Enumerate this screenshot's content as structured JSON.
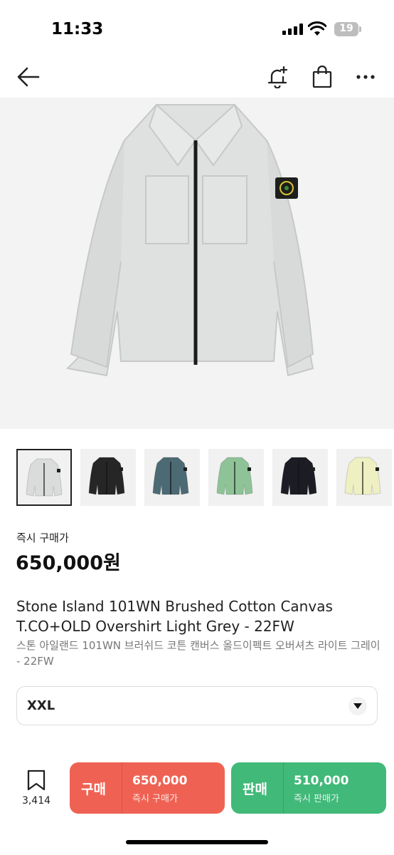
{
  "status_bar": {
    "time": "11:33",
    "battery": "19",
    "battery_level": 0.19
  },
  "nav": {
    "icons": [
      "back-arrow-icon",
      "notification-add-icon",
      "shopping-bag-icon",
      "more-icon"
    ]
  },
  "product": {
    "price_label": "즉시 구매가",
    "price": "650,000원",
    "title": "Stone Island 101WN Brushed Cotton Canvas T.CO+OLD Overshirt Light Grey - 22FW",
    "subtitle": "스톤 아일랜드 101WN 브러쉬드 코튼 캔버스 올드이펙트 오버셔츠 라이트 그레이 - 22FW"
  },
  "thumbnails": [
    {
      "color": "#d9dcdb",
      "selected": true
    },
    {
      "color": "#262626",
      "selected": false
    },
    {
      "color": "#4c6a74",
      "selected": false
    },
    {
      "color": "#8ec297",
      "selected": false
    },
    {
      "color": "#1c1d24",
      "selected": false
    },
    {
      "color": "#eef0c2",
      "selected": false
    }
  ],
  "size": {
    "value": "XXL"
  },
  "bottom_bar": {
    "wish_count": "3,414",
    "buy": {
      "label": "구매",
      "price": "650,000",
      "sub": "즉시 구매가"
    },
    "sell": {
      "label": "판매",
      "price": "510,000",
      "sub": "즉시 판매가"
    }
  },
  "colors": {
    "buy": "#ef6253",
    "sell": "#41b979",
    "jacket": "#dfe1e0"
  }
}
